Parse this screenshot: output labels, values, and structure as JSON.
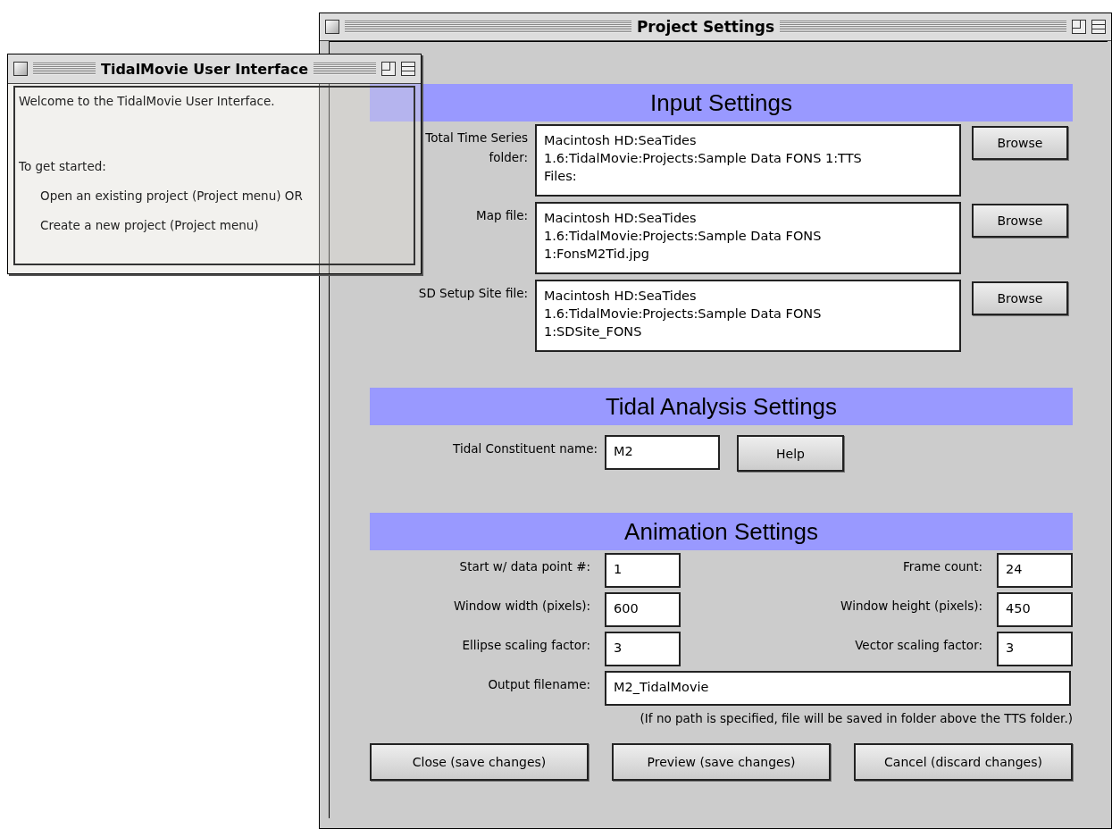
{
  "project_window": {
    "title": "Project Settings",
    "input_settings": {
      "heading": "Input Settings",
      "rows": [
        {
          "label": "Total Time Series folder:",
          "value_lines": [
            "Macintosh HD:SeaTides",
            "1.6:TidalMovie:Projects:Sample Data FONS 1:TTS",
            "Files:"
          ],
          "button": "Browse"
        },
        {
          "label": "Map file:",
          "value_lines": [
            "Macintosh HD:SeaTides",
            "1.6:TidalMovie:Projects:Sample Data FONS",
            "1:FonsM2Tid.jpg"
          ],
          "button": "Browse"
        },
        {
          "label": "SD Setup Site file:",
          "value_lines": [
            "Macintosh HD:SeaTides",
            "1.6:TidalMovie:Projects:Sample Data FONS",
            "1:SDSite_FONS"
          ],
          "button": "Browse"
        }
      ]
    },
    "tidal_analysis": {
      "heading": "Tidal Analysis Settings",
      "label": "Tidal Constituent name:",
      "value": "M2",
      "button": "Help"
    },
    "animation": {
      "heading": "Animation Settings",
      "rows": [
        {
          "left": {
            "label": "Start w/ data point #:",
            "value": "1"
          },
          "right": {
            "label": "Frame count:",
            "value": "24"
          }
        },
        {
          "left": {
            "label": "Window width (pixels):",
            "value": "600"
          },
          "right": {
            "label": "Window height (pixels):",
            "value": "450"
          }
        },
        {
          "left": {
            "label": "Ellipse scaling factor:",
            "value": "3"
          },
          "right": {
            "label": "Vector scaling factor:",
            "value": "3"
          }
        }
      ],
      "output": {
        "label": "Output filename:",
        "value": "M2_TidalMovie"
      },
      "note": "(If no path is specified, file will be saved in folder above the TTS folder.)"
    },
    "buttons": [
      "Close (save changes)",
      "Preview (save changes)",
      "Cancel (discard changes)"
    ]
  },
  "welcome_window": {
    "title": "TidalMovie User Interface",
    "lines": [
      {
        "kind": "text",
        "text": "Welcome to the TidalMovie User Interface."
      },
      {
        "kind": "gap"
      },
      {
        "kind": "text",
        "text": "To get started:"
      },
      {
        "kind": "item",
        "text": "Open an existing project (Project menu) OR"
      },
      {
        "kind": "item",
        "text": "Create a new project (Project menu)"
      }
    ]
  }
}
